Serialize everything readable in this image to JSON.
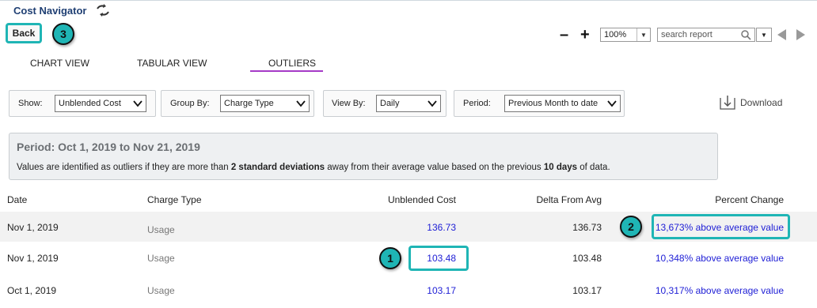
{
  "app": {
    "title": "Cost Navigator",
    "sync_icon": "swap-arrows-icon"
  },
  "toolbar": {
    "back_label": "Back",
    "zoom_value": "100%",
    "search_placeholder": "search report"
  },
  "annotations": [
    "1",
    "2",
    "3"
  ],
  "tabs": [
    {
      "label": "CHART VIEW",
      "active": false
    },
    {
      "label": "TABULAR VIEW",
      "active": false
    },
    {
      "label": "OUTLIERS",
      "active": true
    }
  ],
  "filters": {
    "show": {
      "label": "Show:",
      "value": "Unblended Cost"
    },
    "group_by": {
      "label": "Group By:",
      "value": "Charge Type"
    },
    "view_by": {
      "label": "View By:",
      "value": "Daily"
    },
    "period": {
      "label": "Period:",
      "value": "Previous Month to date"
    }
  },
  "download_label": "Download",
  "period_info": {
    "title": "Period: Oct 1, 2019 to Nov 21, 2019",
    "note_pre": "Values are identified as outliers if they are more than ",
    "note_bold1": "2 standard deviations",
    "note_mid": " away from their average value based on the previous ",
    "note_bold2": "10 days",
    "note_post": " of data."
  },
  "table": {
    "headers": [
      "Date",
      "Charge Type",
      "Unblended Cost",
      "Delta From Avg",
      "Percent Change"
    ],
    "rows": [
      {
        "date": "Nov 1, 2019",
        "charge_type": "Usage",
        "cost": "136.73",
        "delta": "136.73",
        "percent": "13,673% above average value"
      },
      {
        "date": "Nov 1, 2019",
        "charge_type": "Usage",
        "cost": "103.48",
        "delta": "103.48",
        "percent": "10,348% above average value"
      },
      {
        "date": "Oct 1, 2019",
        "charge_type": "Usage",
        "cost": "103.17",
        "delta": "103.17",
        "percent": "10,317% above average value"
      }
    ]
  },
  "colors": {
    "accent": "#1fb5b5",
    "link": "#2020d6",
    "tab_underline": "#a53ac7",
    "title": "#1f3f73"
  }
}
